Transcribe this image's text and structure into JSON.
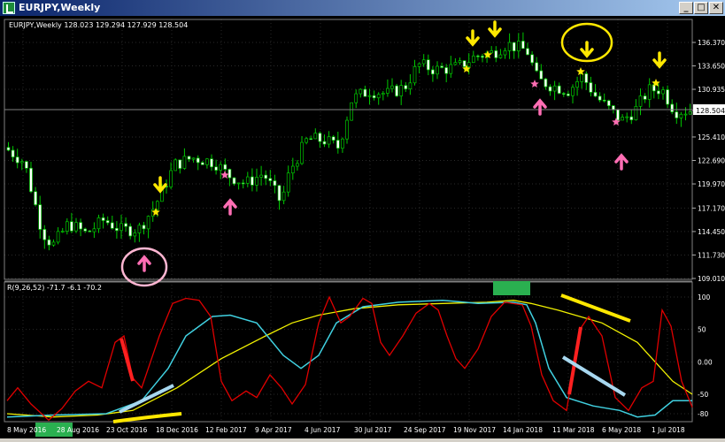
{
  "window": {
    "title": "EURJPY,Weekly",
    "icon": "chart-window-icon",
    "buttons": {
      "minimize": "_",
      "maximize": "□",
      "close": "✕"
    }
  },
  "chart": {
    "info_line": "EURJPY,Weekly  128.023 129.294 127.929 128.504",
    "price_levels": [
      "136.370",
      "133.650",
      "130.935",
      "128.504",
      "125.410",
      "122.690",
      "119.970",
      "117.170",
      "114.450",
      "111.730",
      "109.010"
    ],
    "current_price": "128.504",
    "indicator_label": "R(9,26,52) -71.7 -6.1 -70.2",
    "indicator_levels": [
      "100",
      "50",
      "0.00",
      "-50",
      "-80"
    ],
    "date_labels": [
      "8 May 2016",
      "28 Aug 2016",
      "23 Oct 2016",
      "18 Dec 2016",
      "12 Feb 2017",
      "9 Apr 2017",
      "4 Jun 2017",
      "30 Jul 2017",
      "24 Sep 2017",
      "19 Nov 2017",
      "14 Jan 2018",
      "11 Mar 2018",
      "6 May 2018",
      "1 Jul 2018"
    ],
    "colors": {
      "background": "#000000",
      "candle": "#00c800",
      "candle_bull_body": "#000000",
      "candle_bear_body": "#ffffff",
      "line_red": "#e00000",
      "line_cyan": "#40d0e0",
      "line_yellow": "#f0f000",
      "annotation_yellow": "#ffe800",
      "annotation_pink": "#ff6eb4",
      "green_block": "#2ab050"
    }
  }
}
